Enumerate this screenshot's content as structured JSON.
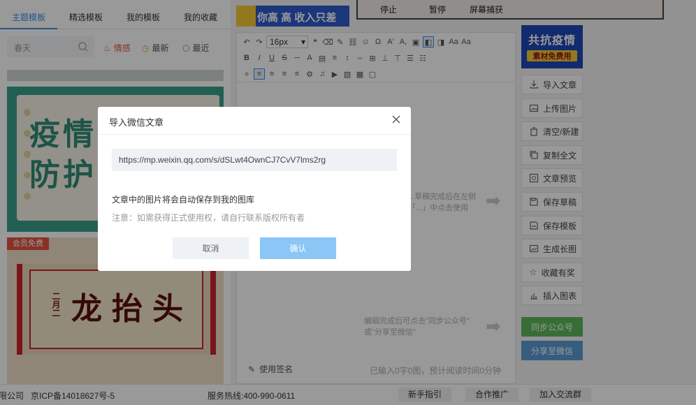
{
  "left_panel": {
    "tabs": [
      {
        "label": "主题模板",
        "active": true
      },
      {
        "label": "精选模板",
        "active": false
      },
      {
        "label": "我的模板",
        "active": false
      },
      {
        "label": "我的收藏",
        "active": false
      }
    ],
    "search": {
      "placeholder": "春天"
    },
    "filters": {
      "hot": "情感",
      "latest": "最新",
      "recent": "最近"
    },
    "card1_text": "疫情防护",
    "card2": {
      "badge": "会员免费",
      "side": "二月二",
      "title": "龙抬头"
    }
  },
  "editor": {
    "banner_text": "你高 高 收入只差",
    "recorder": {
      "stop": "停止",
      "pause": "暂停",
      "capture": "屏幕捕获"
    },
    "toolbar": {
      "font_size": "16px"
    },
    "hint1": "...草稿完成后在左侧\n「...」中点击使用",
    "hint2": "编辑完成后可点击\"同步公众号\"\n或\"分享至微信\"",
    "use_signature": "使用签名",
    "word_count": "已输入0字0图，预计阅读时间0分钟"
  },
  "promo": {
    "line1": "共抗疫情",
    "line2": "素材免费用"
  },
  "sidebar_actions": [
    "导入文章",
    "上传图片",
    "清空/新建",
    "复制全文",
    "文章预览",
    "保存草稿",
    "保存模板",
    "生成长图",
    "收藏有奖",
    "插入图表"
  ],
  "sync_button": "同步公众号",
  "share_button": "分享至微信",
  "footer": {
    "company_suffix": "限公司",
    "icp": "京ICP备14018627号-5",
    "hotline": "服务热线:400-990-0611",
    "guide": "新手指引",
    "cooperate": "合作推广",
    "join": "加入交流群"
  },
  "modal": {
    "title": "导入微信文章",
    "url_value": "https://mp.weixin.qq.com/s/dSLwt4OwnCJ7CvV7lms2rg",
    "info": "文章中的图片将会自动保存到我的图库",
    "note": "注意：如需获得正式使用权，请自行联系版权所有者",
    "cancel": "取消",
    "confirm": "确认"
  },
  "colors": {
    "accent": "#3a8ee6",
    "confirm": "#8cc6f7",
    "hot": "#e5533f",
    "sync": "#5cb85c",
    "share": "#5b9bd5"
  }
}
